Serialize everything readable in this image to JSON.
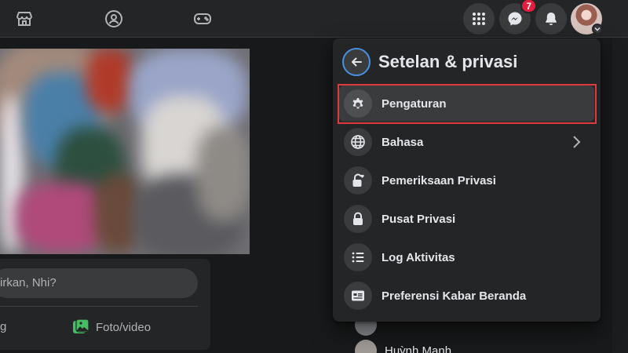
{
  "topbar": {
    "nav_icons": [
      "marketplace-icon",
      "groups-icon",
      "gaming-icon"
    ],
    "right_icons": [
      "menu-grid-icon",
      "messenger-icon",
      "notifications-icon"
    ],
    "messenger_badge": "7"
  },
  "composer": {
    "placeholder": "irkan, Nhi?",
    "left_action": "g",
    "photo_label": "Foto/video"
  },
  "contacts": [
    {
      "name": "Huỳnh Mạnh"
    }
  ],
  "menu": {
    "title": "Setelan & privasi",
    "items": [
      {
        "label": "Pengaturan",
        "icon": "gear-icon",
        "highlighted": true
      },
      {
        "label": "Bahasa",
        "icon": "globe-icon",
        "has_chevron": true
      },
      {
        "label": "Pemeriksaan Privasi",
        "icon": "lock-heart-icon"
      },
      {
        "label": "Pusat Privasi",
        "icon": "lock-icon"
      },
      {
        "label": "Log Aktivitas",
        "icon": "list-icon"
      },
      {
        "label": "Preferensi Kabar Beranda",
        "icon": "feed-icon"
      }
    ]
  },
  "colors": {
    "highlight": "#e0393e",
    "badge": "#e41e3f",
    "back_ring": "#4a90e2"
  }
}
